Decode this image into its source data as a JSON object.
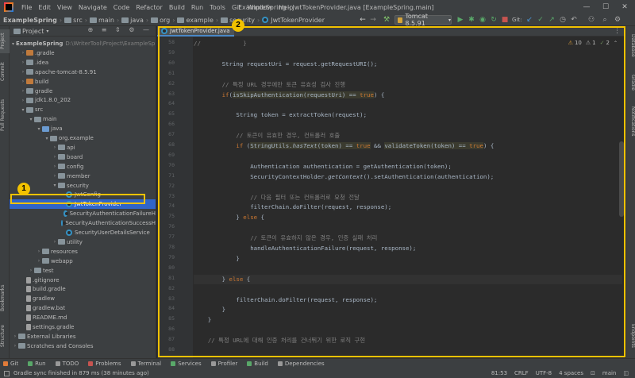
{
  "menubar": {
    "menus": [
      "File",
      "Edit",
      "View",
      "Navigate",
      "Code",
      "Refactor",
      "Build",
      "Run",
      "Tools",
      "Git",
      "Window",
      "Help"
    ],
    "window_title": "ExampleSpring - JwtTokenProvider.java [ExampleSpring.main]"
  },
  "breadcrumb": [
    "ExampleSpring",
    "src",
    "main",
    "java",
    "org",
    "example",
    "security",
    "JwtTokenProvider"
  ],
  "run_config": "Tomcat 8.5.91",
  "git_label": "Git:",
  "left_tabs": [
    "Project",
    "Commit",
    "Pull Requests",
    "Bookmarks",
    "Structure"
  ],
  "right_tabs": [
    "Database",
    "Gradle",
    "Notifications",
    "Endpoints"
  ],
  "project_panel": {
    "title": "Project",
    "tree": [
      {
        "label": "ExampleSpring",
        "path": "D:\\WriterTool\\Project\\ExampleSpring",
        "depth": 0,
        "arrow": "▾",
        "icon": "folder"
      },
      {
        "label": ".gradle",
        "depth": 1,
        "arrow": "›",
        "icon": "orange"
      },
      {
        "label": ".idea",
        "depth": 1,
        "arrow": "›",
        "icon": "folder"
      },
      {
        "label": "apache-tomcat-8.5.91",
        "depth": 1,
        "arrow": "›",
        "icon": "folder"
      },
      {
        "label": "build",
        "depth": 1,
        "arrow": "›",
        "icon": "orange"
      },
      {
        "label": "gradle",
        "depth": 1,
        "arrow": "›",
        "icon": "folder"
      },
      {
        "label": "jdk1.8.0_202",
        "depth": 1,
        "arrow": "›",
        "icon": "folder"
      },
      {
        "label": "src",
        "depth": 1,
        "arrow": "▾",
        "icon": "folder"
      },
      {
        "label": "main",
        "depth": 2,
        "arrow": "▾",
        "icon": "folder"
      },
      {
        "label": "java",
        "depth": 3,
        "arrow": "▾",
        "icon": "blue"
      },
      {
        "label": "org.example",
        "depth": 4,
        "arrow": "▾",
        "icon": "folder"
      },
      {
        "label": "api",
        "depth": 5,
        "arrow": "›",
        "icon": "folder"
      },
      {
        "label": "board",
        "depth": 5,
        "arrow": "›",
        "icon": "folder"
      },
      {
        "label": "config",
        "depth": 5,
        "arrow": "›",
        "icon": "folder"
      },
      {
        "label": "member",
        "depth": 5,
        "arrow": "›",
        "icon": "folder"
      },
      {
        "label": "security",
        "depth": 5,
        "arrow": "▾",
        "icon": "folder"
      },
      {
        "label": "JwtConfig",
        "depth": 6,
        "arrow": "",
        "icon": "class"
      },
      {
        "label": "JwtTokenProvider",
        "depth": 6,
        "arrow": "",
        "icon": "class",
        "selected": true
      },
      {
        "label": "SecurityAuthenticationFailureH",
        "depth": 6,
        "arrow": "",
        "icon": "class"
      },
      {
        "label": "SecurityAuthenticationSuccessH",
        "depth": 6,
        "arrow": "",
        "icon": "class"
      },
      {
        "label": "SecurityUserDetailsService",
        "depth": 6,
        "arrow": "",
        "icon": "class"
      },
      {
        "label": "utility",
        "depth": 5,
        "arrow": "›",
        "icon": "folder"
      },
      {
        "label": "resources",
        "depth": 3,
        "arrow": "›",
        "icon": "folder"
      },
      {
        "label": "webapp",
        "depth": 3,
        "arrow": "›",
        "icon": "folder"
      },
      {
        "label": "test",
        "depth": 2,
        "arrow": "›",
        "icon": "folder"
      },
      {
        "label": ".gitignore",
        "depth": 1,
        "arrow": "",
        "icon": "file"
      },
      {
        "label": "build.gradle",
        "depth": 1,
        "arrow": "",
        "icon": "file"
      },
      {
        "label": "gradlew",
        "depth": 1,
        "arrow": "",
        "icon": "file"
      },
      {
        "label": "gradlew.bat",
        "depth": 1,
        "arrow": "",
        "icon": "file"
      },
      {
        "label": "README.md",
        "depth": 1,
        "arrow": "",
        "icon": "file"
      },
      {
        "label": "settings.gradle",
        "depth": 1,
        "arrow": "",
        "icon": "file"
      },
      {
        "label": "External Libraries",
        "depth": 0,
        "arrow": "›",
        "icon": "folder"
      },
      {
        "label": "Scratches and Consoles",
        "depth": 0,
        "arrow": "›",
        "icon": "folder"
      }
    ]
  },
  "editor": {
    "tab": "JwtTokenProvider.java",
    "inspections": {
      "warnings": "10",
      "weak": "1",
      "typos": "2"
    },
    "lines": [
      {
        "n": "58",
        "html": "<span class=\"cm\">//            }</span>"
      },
      {
        "n": "59",
        "html": ""
      },
      {
        "n": "60",
        "html": "        String requestUri = request.getRequestURI();"
      },
      {
        "n": "61",
        "html": ""
      },
      {
        "n": "62",
        "html": "        <span class=\"cm\">// 특정 URL 경우에만 토큰 유효성 검사 진행</span>"
      },
      {
        "n": "63",
        "html": "        <span class=\"kw\">if</span>(<span class=\"hl\">isSkipAuthentication(requestUri) == <span class=\"kw\">true</span></span>) {"
      },
      {
        "n": "64",
        "html": ""
      },
      {
        "n": "65",
        "html": "            String token = extractToken(request);"
      },
      {
        "n": "66",
        "html": ""
      },
      {
        "n": "67",
        "html": "            <span class=\"cm\">// 토큰이 유효한 경우, 컨트롤러 호출</span>"
      },
      {
        "n": "68",
        "html": "            <span class=\"kw\">if</span> (<span class=\"hl\">StringUtils.<span class=\"it\">hasText</span>(token) == <span class=\"kw\">true</span></span> &amp;&amp; <span class=\"hl\">validateToken(token) == <span class=\"kw\">true</span></span>) {"
      },
      {
        "n": "69",
        "html": ""
      },
      {
        "n": "70",
        "html": "                Authentication authentication = getAuthentication(token);"
      },
      {
        "n": "71",
        "html": "                SecurityContextHolder.<span class=\"it\">getContext</span>().setAuthentication(authentication);"
      },
      {
        "n": "72",
        "html": ""
      },
      {
        "n": "73",
        "html": "                <span class=\"cm\">// 다음 필터 또는 컨트롤러로 요청 전달</span>"
      },
      {
        "n": "74",
        "html": "                filterChain.doFilter(request, response);"
      },
      {
        "n": "75",
        "html": "            } <span class=\"kw\">else</span> {"
      },
      {
        "n": "76",
        "html": ""
      },
      {
        "n": "77",
        "html": "                <span class=\"cm\">// 토큰이 유효하지 않은 경우, 인증 실패 처리</span>"
      },
      {
        "n": "78",
        "html": "                handleAuthenticationFailure(request, response);"
      },
      {
        "n": "79",
        "html": "            }"
      },
      {
        "n": "80",
        "html": ""
      },
      {
        "n": "81",
        "html": "        } <span class=\"kw\">else</span> {"
      },
      {
        "n": "82",
        "html": ""
      },
      {
        "n": "83",
        "html": "            filterChain.doFilter(request, response);"
      },
      {
        "n": "84",
        "html": "        }"
      },
      {
        "n": "85",
        "html": "    }"
      },
      {
        "n": "86",
        "html": ""
      },
      {
        "n": "87",
        "html": "    <span class=\"cm\">// 특정 URL에 대해 인증 처리를 건너뛰기 위한 로직 구현</span>"
      },
      {
        "n": "88",
        "html": ""
      }
    ]
  },
  "tool_tabs": [
    "Git",
    "Run",
    "TODO",
    "Problems",
    "Terminal",
    "Services",
    "Profiler",
    "Build",
    "Dependencies"
  ],
  "status": {
    "message": "Gradle sync finished in 879 ms (38 minutes ago)",
    "position": "81:53",
    "line_sep": "CRLF",
    "encoding": "UTF-8",
    "indent": "4 spaces",
    "branch": "main"
  },
  "annotations": [
    "1",
    "2"
  ],
  "colors": {
    "annotation": "#f2c200",
    "selection": "#2f65ca",
    "keyword": "#cc7832",
    "comment": "#808080"
  }
}
